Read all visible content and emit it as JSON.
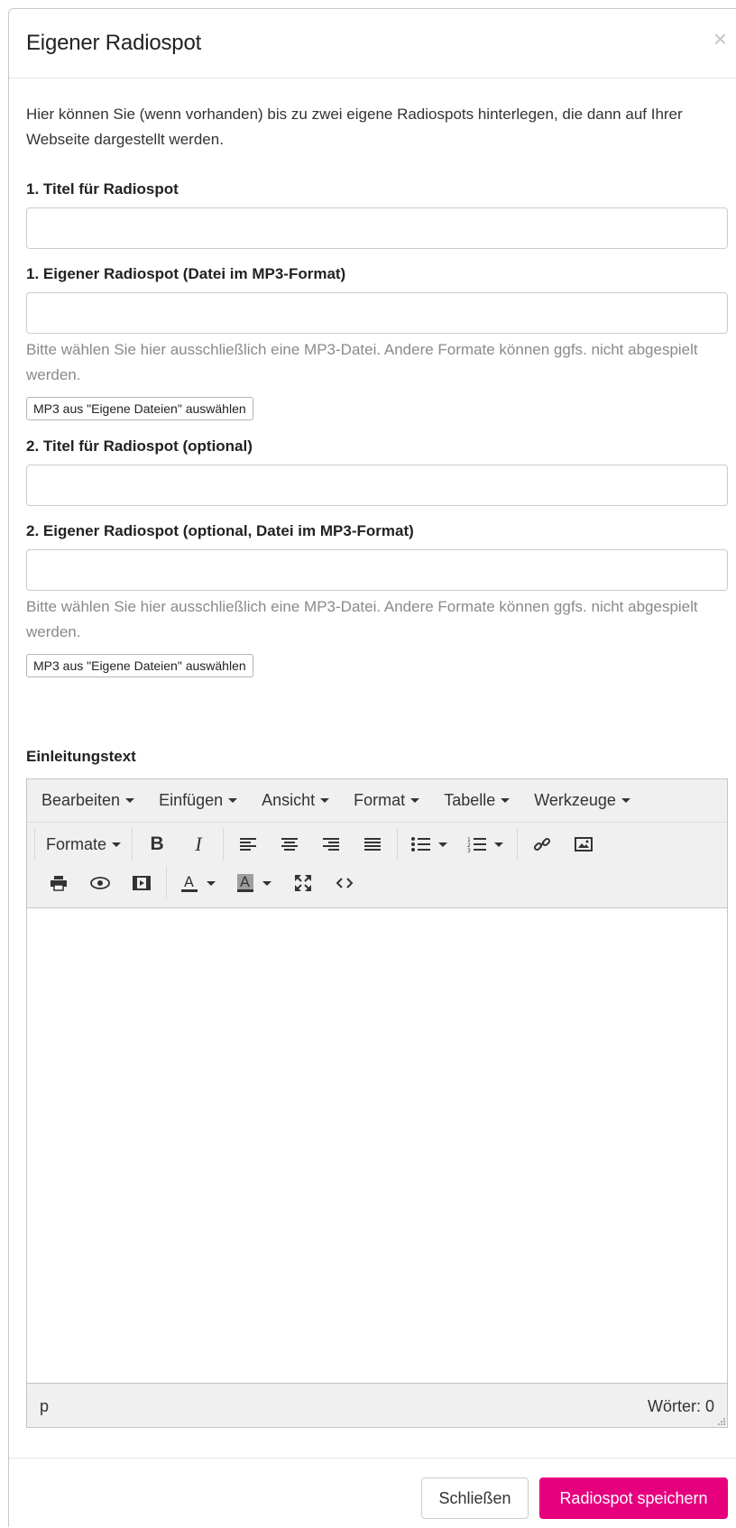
{
  "dialog": {
    "title": "Eigener Radiospot",
    "close_glyph": "×"
  },
  "intro": "Hier können Sie (wenn vorhanden) bis zu zwei eigene Radiospots hinterlegen, die dann auf Ihrer Webseite dargestellt werden.",
  "fields": {
    "title1_label": "1. Titel für Radiospot",
    "title1_value": "",
    "spot1_label": "1. Eigener Radiospot (Datei im MP3-Format)",
    "spot1_value": "",
    "spot1_help": "Bitte wählen Sie hier ausschließlich eine MP3-Datei. Andere Formate können ggfs. nicht abgespielt werden.",
    "spot1_button": "MP3 aus \"Eigene Dateien\" auswählen",
    "title2_label": "2. Titel für Radiospot (optional)",
    "title2_value": "",
    "spot2_label": "2. Eigener Radiospot (optional, Datei im MP3-Format)",
    "spot2_value": "",
    "spot2_help": "Bitte wählen Sie hier ausschließlich eine MP3-Datei. Andere Formate können ggfs. nicht abgespielt werden.",
    "spot2_button": "MP3 aus \"Eigene Dateien\" auswählen",
    "intro_text_label": "Einleitungstext"
  },
  "editor": {
    "menu": [
      "Bearbeiten",
      "Einfügen",
      "Ansicht",
      "Format",
      "Tabelle",
      "Werkzeuge"
    ],
    "formats_label": "Formate",
    "status_path": "p",
    "word_count": "Wörter: 0",
    "icons": [
      "bold-icon",
      "italic-icon",
      "align-left-icon",
      "align-center-icon",
      "align-right-icon",
      "align-justify-icon",
      "bullet-list-icon",
      "numbered-list-icon",
      "link-icon",
      "image-icon",
      "print-icon",
      "preview-icon",
      "media-icon",
      "text-color-icon",
      "background-color-icon",
      "fullscreen-icon",
      "source-code-icon"
    ]
  },
  "footer": {
    "close_label": "Schließen",
    "save_label": "Radiospot speichern"
  },
  "colors": {
    "accent": "#e6007e",
    "help_text": "#8a8a8a"
  }
}
